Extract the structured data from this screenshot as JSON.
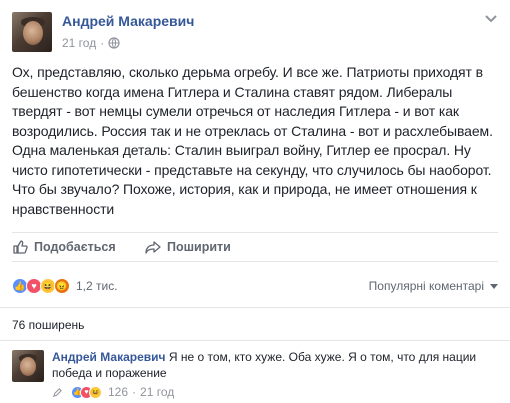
{
  "post": {
    "author": "Андрей Макаревич",
    "time": "21 год",
    "privacy_icon": "globe-icon",
    "text": "Ох, представляю, сколько дерьма огребу. И все же. Патриоты приходят в бешенство когда имена Гитлера и Сталина ставят рядом. Либералы твердят - вот немцы сумели отречься от наследия Гитлера - и вот как возродились. Россия так и не отреклась от Сталина - вот и расхлебываем. Одна маленькая деталь: Сталин выиграл войну, Гитлер ее просрал. Ну чисто гипотетически - представьте на секунду, что случилось бы наоборот. Что бы звучало? Похоже, история, как и природа, не имеет отношения к нравственности"
  },
  "actions": {
    "like_label": "Подобається",
    "share_label": "Поширити"
  },
  "reactions": {
    "count": "1,2 тис.",
    "types": [
      "like",
      "love",
      "haha",
      "angry"
    ],
    "sort_label": "Популярні коментарі"
  },
  "shares": {
    "label": "76 поширень"
  },
  "comment": {
    "author": "Андрей Макаревич",
    "text": "Я не о том, кто хуже. Оба хуже. Я о том, что для нации победа и поражение",
    "count": "126",
    "time": "21 год",
    "separator": "·"
  },
  "colors": {
    "link": "#365899",
    "text": "#1d2129",
    "muted": "#90949c",
    "like_blue": "#5890ff"
  }
}
